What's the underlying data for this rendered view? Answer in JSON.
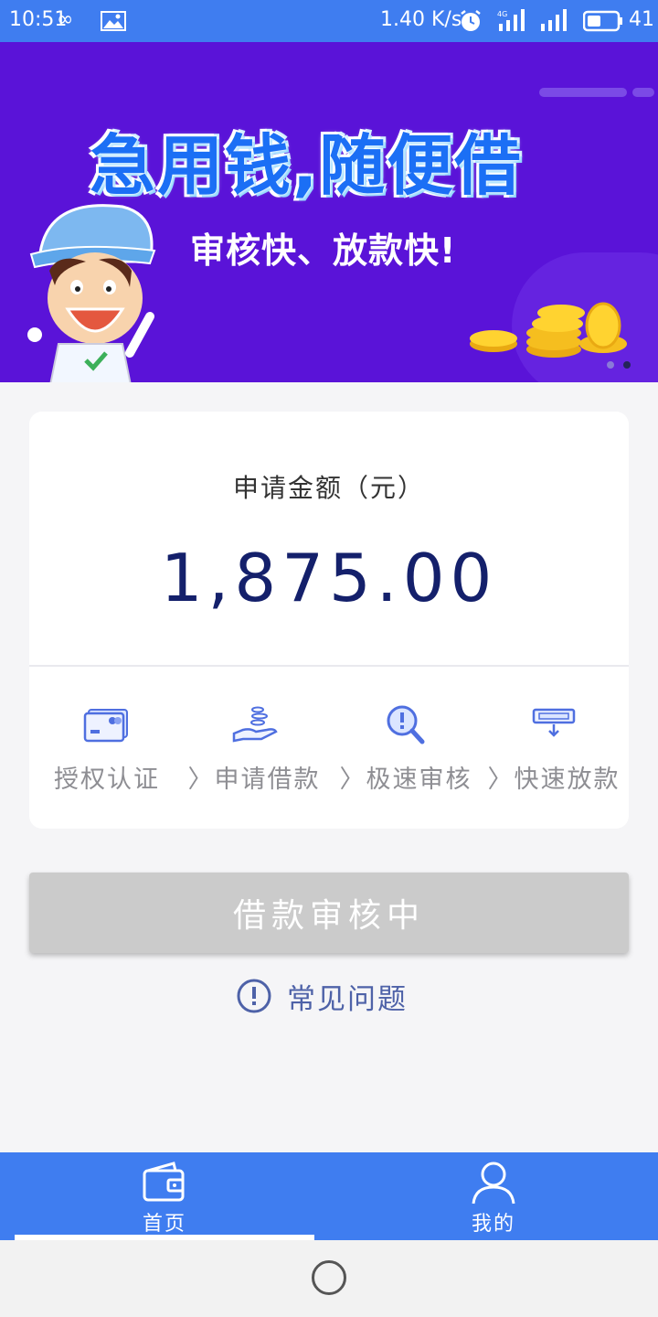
{
  "status_bar": {
    "time": "10:51",
    "network_speed": "1.40 K/s",
    "battery_level": "41",
    "icons": [
      "infinity-icon",
      "image-icon",
      "alarm-icon",
      "signal-4g-icon",
      "signal-icon",
      "battery-icon"
    ]
  },
  "banner": {
    "title": "急用钱,随便借",
    "subtitle": "审核快、放款快!",
    "colors": {
      "background": "#5a13d8",
      "title": "#1b6ff5"
    },
    "dots": {
      "count": 2,
      "active_index": 1
    }
  },
  "loan_card": {
    "amount_label": "申请金额（元）",
    "amount_value": "1,875.00",
    "steps": [
      {
        "icon": "credit-card-icon",
        "label": "授权认证"
      },
      {
        "icon": "hand-coins-icon",
        "label": "〉申请借款"
      },
      {
        "icon": "magnifier-alert-icon",
        "label": "〉极速审核"
      },
      {
        "icon": "cash-download-icon",
        "label": "〉快速放款"
      }
    ]
  },
  "action_button": {
    "label": "借款审核中",
    "state": "disabled"
  },
  "faq": {
    "label": "常见问题",
    "icon": "info-circle-icon"
  },
  "tab_bar": {
    "tabs": [
      {
        "label": "首页",
        "icon": "wallet-icon",
        "active": true
      },
      {
        "label": "我的",
        "icon": "user-icon",
        "active": false
      }
    ],
    "color": "#3f7df0"
  },
  "system_nav": {
    "icon": "home-circle-icon"
  }
}
